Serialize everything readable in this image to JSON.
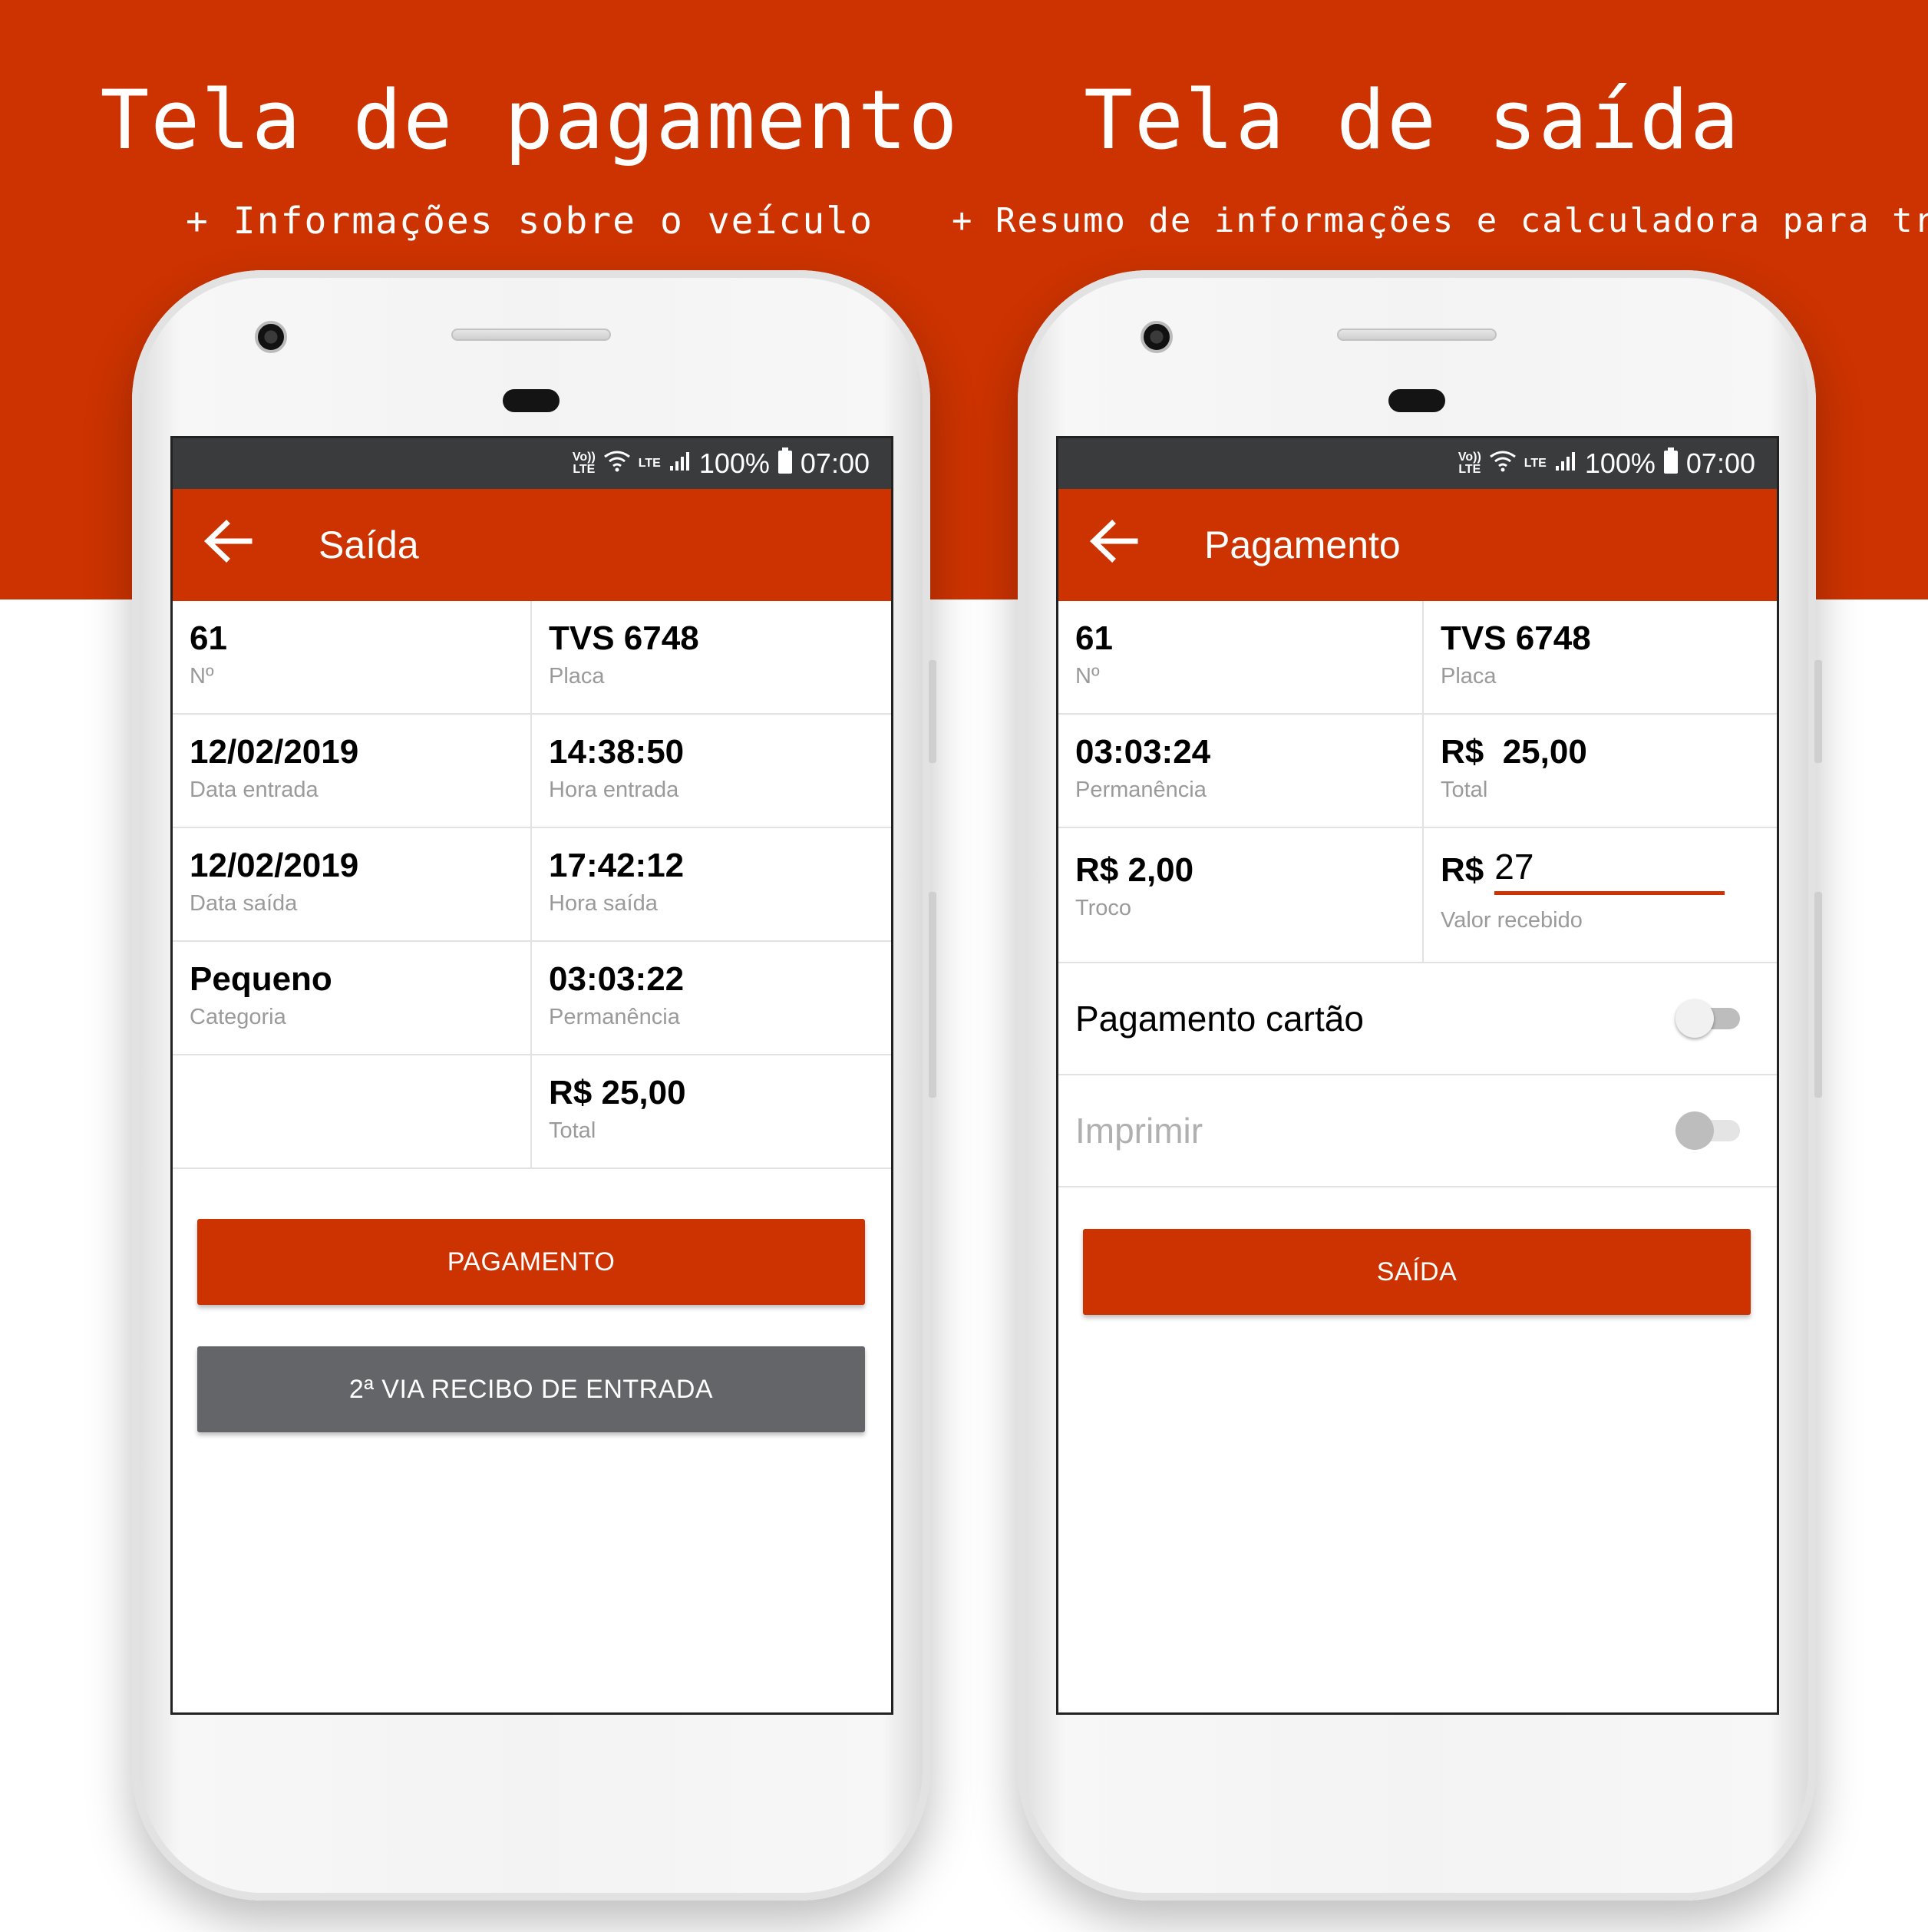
{
  "colors": {
    "brand_red": "#cc3300",
    "status_bar": "#3a3b3d",
    "secondary_button": "#646568"
  },
  "headlines": {
    "left": {
      "title": "Tela de pagamento",
      "subtitle": "+ Informações sobre o veículo"
    },
    "right": {
      "title": "Tela de saída",
      "subtitle": "+ Resumo de informações e calculadora para troco"
    }
  },
  "status_bar": {
    "volte_top": "Vo))",
    "volte_bottom": "LTE",
    "wifi_icon": "wifi-icon",
    "lte_label": "LTE",
    "signal_icon": "signal-icon",
    "battery_pct": "100%",
    "battery_icon": "battery-icon",
    "time": "07:00"
  },
  "left_screen": {
    "app_bar": {
      "back_icon": "arrow-left-icon",
      "title": "Saída"
    },
    "rows": [
      [
        {
          "value": "61",
          "label": "Nº"
        },
        {
          "value": "TVS 6748",
          "label": "Placa"
        }
      ],
      [
        {
          "value": "12/02/2019",
          "label": "Data entrada"
        },
        {
          "value": "14:38:50",
          "label": "Hora entrada"
        }
      ],
      [
        {
          "value": "12/02/2019",
          "label": "Data saída"
        },
        {
          "value": "17:42:12",
          "label": "Hora saída"
        }
      ],
      [
        {
          "value": "Pequeno",
          "label": "Categoria"
        },
        {
          "value": "03:03:22",
          "label": "Permanência"
        }
      ],
      [
        {
          "value": "",
          "label": ""
        },
        {
          "value": "R$ 25,00",
          "label": "Total"
        }
      ]
    ],
    "buttons": {
      "pagamento": "PAGAMENTO",
      "segunda_via": "2ª VIA RECIBO DE ENTRADA"
    }
  },
  "right_screen": {
    "app_bar": {
      "back_icon": "arrow-left-icon",
      "title": "Pagamento"
    },
    "rows": [
      [
        {
          "value": "61",
          "label": "Nº"
        },
        {
          "value": "TVS 6748",
          "label": "Placa"
        }
      ],
      [
        {
          "value": "03:03:24",
          "label": "Permanência"
        },
        {
          "value": "R$  25,00",
          "label": "Total"
        }
      ]
    ],
    "troco": {
      "value": "R$ 2,00",
      "label": "Troco"
    },
    "valor_recebido": {
      "currency": "R$",
      "value": "27",
      "label": "Valor recebido"
    },
    "toggles": {
      "pagamento_cartao": {
        "label": "Pagamento cartão",
        "state": "off"
      },
      "imprimir": {
        "label": "Imprimir",
        "state": "off-disabled"
      }
    },
    "buttons": {
      "saida": "SAÍDA"
    }
  }
}
